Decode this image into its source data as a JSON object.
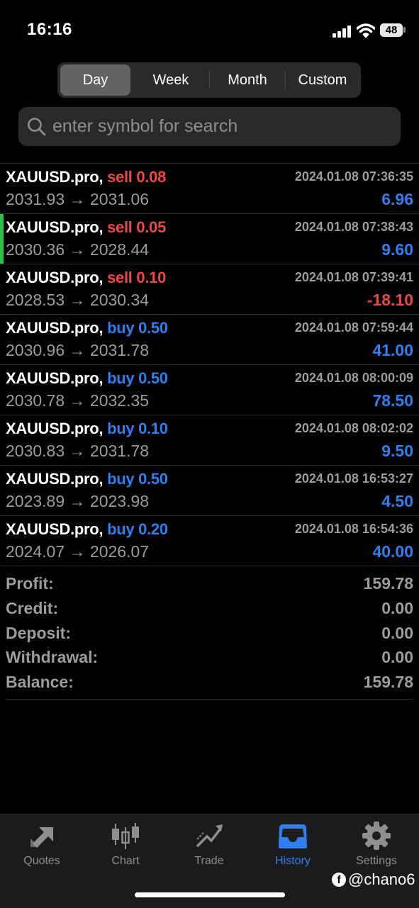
{
  "status": {
    "time": "16:16",
    "battery": "48"
  },
  "periods": [
    "Day",
    "Week",
    "Month",
    "Custom"
  ],
  "active_period": "Day",
  "search": {
    "placeholder": "enter symbol for search",
    "value": ""
  },
  "trades": [
    {
      "symbol": "XAUUSD.pro,",
      "side": "sell",
      "volume": "0.08",
      "time": "2024.01.08 07:36:35",
      "open": "2031.93",
      "close": "2031.06",
      "arrow": "→",
      "profit": "6.96"
    },
    {
      "symbol": "XAUUSD.pro,",
      "side": "sell",
      "volume": "0.05",
      "time": "2024.01.08 07:38:43",
      "open": "2030.36",
      "close": "2028.44",
      "arrow": "→",
      "profit": "9.60"
    },
    {
      "symbol": "XAUUSD.pro,",
      "side": "sell",
      "volume": "0.10",
      "time": "2024.01.08 07:39:41",
      "open": "2028.53",
      "close": "2030.34",
      "arrow": "→",
      "profit": "-18.10"
    },
    {
      "symbol": "XAUUSD.pro,",
      "side": "buy",
      "volume": "0.50",
      "time": "2024.01.08 07:59:44",
      "open": "2030.96",
      "close": "2031.78",
      "arrow": "→",
      "profit": "41.00"
    },
    {
      "symbol": "XAUUSD.pro,",
      "side": "buy",
      "volume": "0.50",
      "time": "2024.01.08 08:00:09",
      "open": "2030.78",
      "close": "2032.35",
      "arrow": "→",
      "profit": "78.50"
    },
    {
      "symbol": "XAUUSD.pro,",
      "side": "buy",
      "volume": "0.10",
      "time": "2024.01.08 08:02:02",
      "open": "2030.83",
      "close": "2031.78",
      "arrow": "→",
      "profit": "9.50"
    },
    {
      "symbol": "XAUUSD.pro,",
      "side": "buy",
      "volume": "0.50",
      "time": "2024.01.08 16:53:27",
      "open": "2023.89",
      "close": "2023.98",
      "arrow": "→",
      "profit": "4.50"
    },
    {
      "symbol": "XAUUSD.pro,",
      "side": "buy",
      "volume": "0.20",
      "time": "2024.01.08 16:54:36",
      "open": "2024.07",
      "close": "2026.07",
      "arrow": "→",
      "profit": "40.00"
    }
  ],
  "selected_trade_index": 1,
  "summary": [
    {
      "label": "Profit:",
      "value": "159.78"
    },
    {
      "label": "Credit:",
      "value": "0.00"
    },
    {
      "label": "Deposit:",
      "value": "0.00"
    },
    {
      "label": "Withdrawal:",
      "value": "0.00"
    },
    {
      "label": "Balance:",
      "value": "159.78"
    }
  ],
  "tabs": [
    {
      "label": "Quotes",
      "icon": "quotes-arrows-icon"
    },
    {
      "label": "Chart",
      "icon": "candlestick-icon"
    },
    {
      "label": "Trade",
      "icon": "trend-chart-icon"
    },
    {
      "label": "History",
      "icon": "inbox-tray-icon"
    },
    {
      "label": "Settings",
      "icon": "gear-icon"
    }
  ],
  "active_tab": "History",
  "colors": {
    "sell": "#f0473f",
    "buy": "#2f7ff0",
    "loss": "#f0473f",
    "profit": "#2f7ff0",
    "selected_marker": "#2ac244",
    "active_tab": "#2f7ff0"
  },
  "watermark": {
    "icon": "f",
    "text": "@chano6"
  }
}
